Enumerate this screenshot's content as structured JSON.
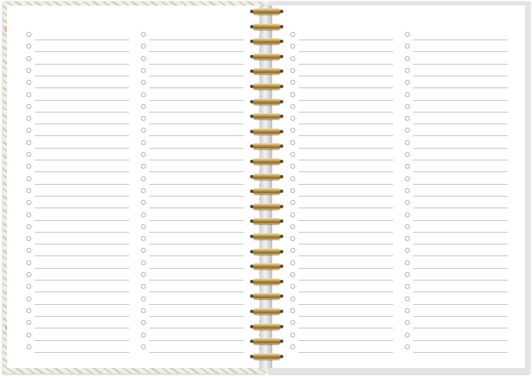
{
  "planner": {
    "left_page": {
      "columns": 2,
      "rows_per_column": 27
    },
    "right_page": {
      "columns": 2,
      "rows_per_column": 27
    },
    "binding": {
      "type": "wire-o",
      "ring_count": 24,
      "color": "#c8a256"
    },
    "cover_left_pattern": "floral",
    "cover_right_color": "#e4e4e4"
  }
}
